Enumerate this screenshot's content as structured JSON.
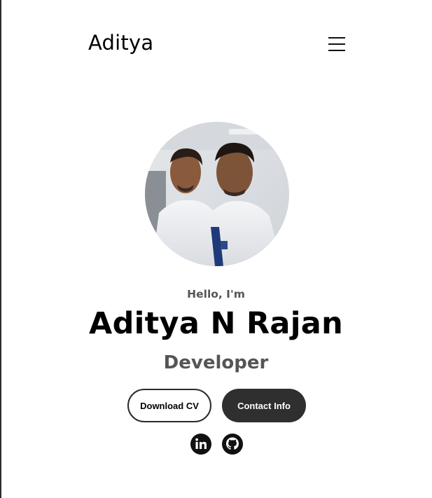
{
  "nav": {
    "logo": "Aditya",
    "menu_icon": "hamburger-menu-icon"
  },
  "profile": {
    "image_icon": "profile-photo",
    "greeting": "Hello, I'm",
    "name": "Aditya N Rajan",
    "role": "Developer"
  },
  "buttons": {
    "download_cv": "Download CV",
    "contact_info": "Contact Info"
  },
  "socials": [
    {
      "icon": "linkedin-icon"
    },
    {
      "icon": "github-icon"
    }
  ],
  "colors": {
    "text_primary": "#000000",
    "text_secondary": "#555555",
    "button_dark": "#2f2f2f",
    "background": "#ffffff"
  }
}
